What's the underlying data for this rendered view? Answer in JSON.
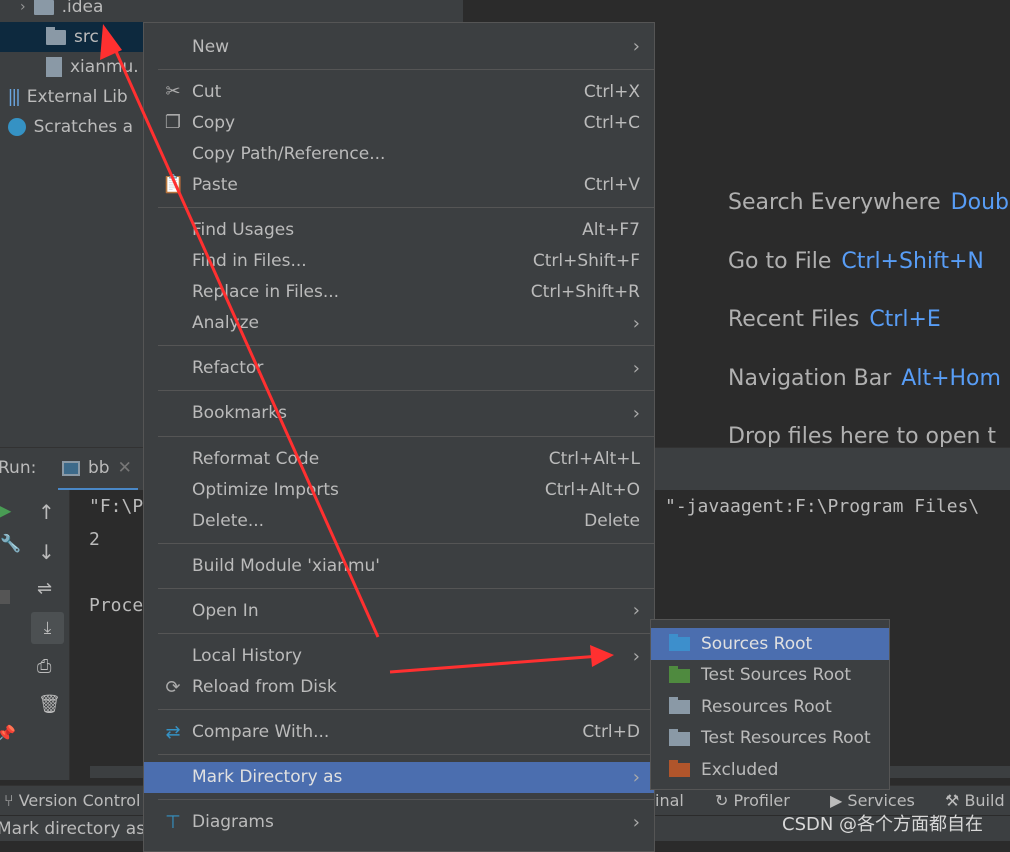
{
  "project_tree": [
    {
      "label": ".idea",
      "icon": "folder-icon",
      "expander": "chevron-right-icon"
    },
    {
      "label": "src",
      "icon": "folder-icon",
      "selected": true
    },
    {
      "label": "xianmu.",
      "icon": "module-file-icon"
    },
    {
      "label": "External Lib",
      "icon": "library-icon",
      "expander": "chevron-right-icon"
    },
    {
      "label": "Scratches a",
      "icon": "scratches-icon",
      "expander": "chevron-right-icon"
    }
  ],
  "editor_hints": [
    {
      "label": "Search Everywhere",
      "key": "Doubl"
    },
    {
      "label": "Go to File",
      "key": "Ctrl+Shift+N"
    },
    {
      "label": "Recent Files",
      "key": "Ctrl+E"
    },
    {
      "label": "Navigation Bar",
      "key": "Alt+Hom"
    },
    {
      "label": "Drop files here to open t",
      "key": ""
    }
  ],
  "run": {
    "label": "Run:",
    "tab": "bb"
  },
  "console": {
    "lines": [
      "\"F:\\P",
      "2",
      "",
      "Proce"
    ],
    "line_right": "\"-javaagent:F:\\Program Files\\"
  },
  "toolstrip": [
    "Version Control",
    "inal",
    "Profiler",
    "Services",
    "Build"
  ],
  "status": "Mark directory as",
  "menu": [
    {
      "label": "New",
      "submenu": true
    },
    {
      "sep": true
    },
    {
      "label": "Cut",
      "shortcut": "Ctrl+X",
      "icon": "scissors-icon"
    },
    {
      "label": "Copy",
      "shortcut": "Ctrl+C",
      "icon": "copy-icon"
    },
    {
      "label": "Copy Path/Reference..."
    },
    {
      "label": "Paste",
      "shortcut": "Ctrl+V",
      "icon": "clipboard-icon"
    },
    {
      "sep": true
    },
    {
      "label": "Find Usages",
      "shortcut": "Alt+F7"
    },
    {
      "label": "Find in Files...",
      "shortcut": "Ctrl+Shift+F"
    },
    {
      "label": "Replace in Files...",
      "shortcut": "Ctrl+Shift+R"
    },
    {
      "label": "Analyze",
      "submenu": true
    },
    {
      "sep": true
    },
    {
      "label": "Refactor",
      "submenu": true
    },
    {
      "sep": true
    },
    {
      "label": "Bookmarks",
      "submenu": true
    },
    {
      "sep": true
    },
    {
      "label": "Reformat Code",
      "shortcut": "Ctrl+Alt+L"
    },
    {
      "label": "Optimize Imports",
      "shortcut": "Ctrl+Alt+O"
    },
    {
      "label": "Delete...",
      "shortcut": "Delete"
    },
    {
      "sep": true
    },
    {
      "label": "Build Module 'xianmu'"
    },
    {
      "sep": true
    },
    {
      "label": "Open In",
      "submenu": true
    },
    {
      "sep": true
    },
    {
      "label": "Local History",
      "submenu": true
    },
    {
      "label": "Reload from Disk",
      "icon": "reload-icon"
    },
    {
      "sep": true
    },
    {
      "label": "Compare With...",
      "shortcut": "Ctrl+D",
      "icon": "compare-icon"
    },
    {
      "sep": true
    },
    {
      "label": "Mark Directory as",
      "submenu": true,
      "selected": true
    },
    {
      "sep": true
    },
    {
      "label": "Diagrams",
      "submenu": true,
      "icon": "diagram-icon"
    }
  ],
  "submenu": [
    {
      "label": "Sources Root",
      "color": "#3d8fcc",
      "selected": true
    },
    {
      "label": "Test Sources Root",
      "color": "#4f8a3f"
    },
    {
      "label": "Resources Root",
      "color": "#8a99a6"
    },
    {
      "label": "Test Resources Root",
      "color": "#8a99a6"
    },
    {
      "label": "Excluded",
      "color": "#b0552b"
    }
  ],
  "annotation_color": "#ff3030",
  "watermark": "CSDN @各个方面都自在"
}
